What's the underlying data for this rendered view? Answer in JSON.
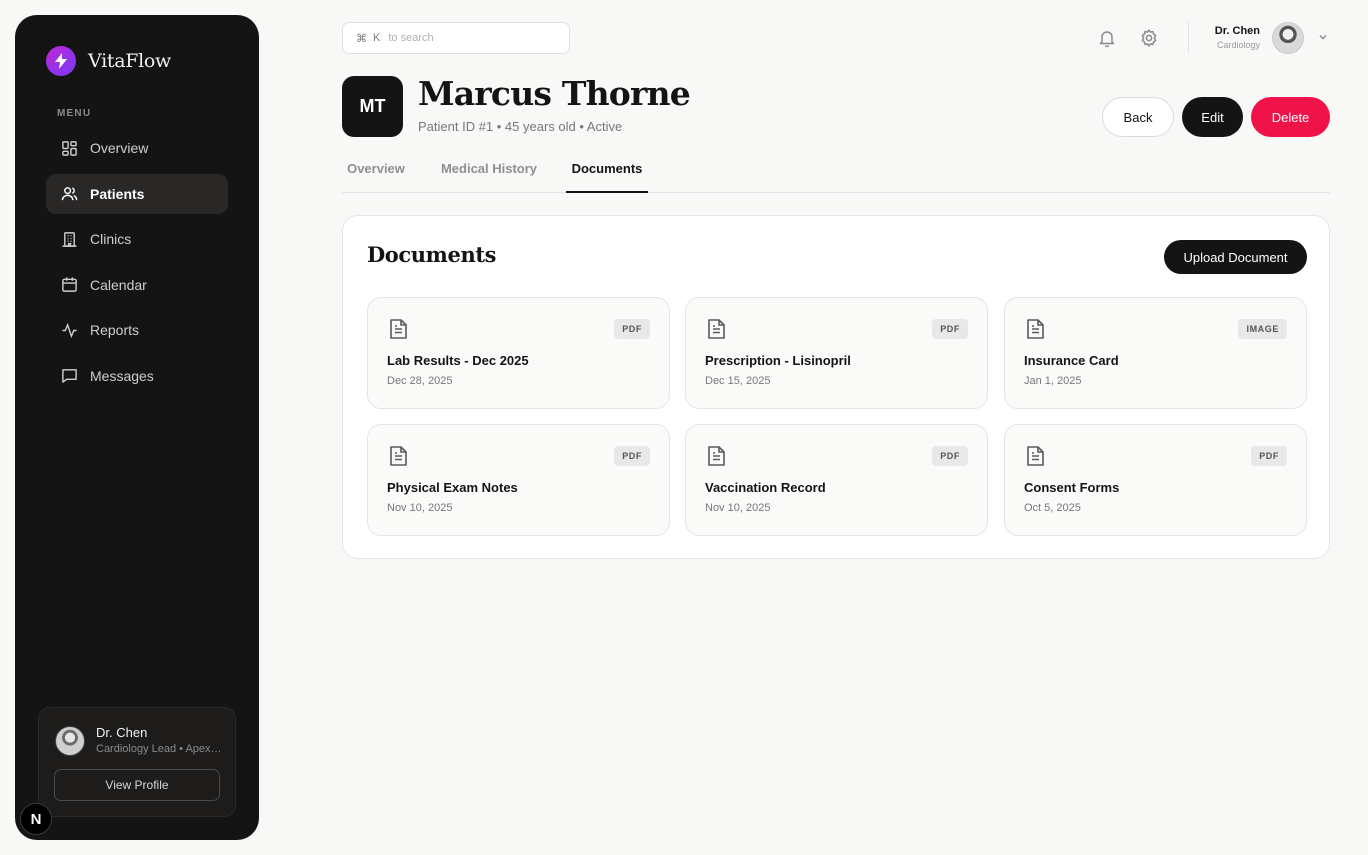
{
  "brand": {
    "name": "VitaFlow"
  },
  "sidebar": {
    "menu_label": "MENU",
    "items": [
      {
        "label": "Overview",
        "icon": "grid-icon",
        "active": false
      },
      {
        "label": "Patients",
        "icon": "users-icon",
        "active": true
      },
      {
        "label": "Clinics",
        "icon": "building-icon",
        "active": false
      },
      {
        "label": "Calendar",
        "icon": "calendar-icon",
        "active": false
      },
      {
        "label": "Reports",
        "icon": "activity-icon",
        "active": false
      },
      {
        "label": "Messages",
        "icon": "message-icon",
        "active": false
      }
    ],
    "profile": {
      "name": "Dr. Chen",
      "role": "Cardiology Lead • Apex Medical",
      "button": "View Profile"
    },
    "badge": "N"
  },
  "topbar": {
    "search_shortcut_symbol": "⌘",
    "search_shortcut_key": "K",
    "search_placeholder": "to search",
    "user_name": "Dr. Chen",
    "user_role": "Cardiology"
  },
  "patient": {
    "initials": "MT",
    "name": "Marcus Thorne",
    "meta": "Patient ID #1 • 45 years old • Active"
  },
  "actions": {
    "back": "Back",
    "edit": "Edit",
    "delete": "Delete"
  },
  "tabs": [
    {
      "label": "Overview",
      "active": false
    },
    {
      "label": "Medical History",
      "active": false
    },
    {
      "label": "Documents",
      "active": true
    }
  ],
  "documents": {
    "title": "Documents",
    "upload_label": "Upload Document",
    "items": [
      {
        "title": "Lab Results - Dec 2025",
        "date": "Dec 28, 2025",
        "type": "PDF"
      },
      {
        "title": "Prescription - Lisinopril",
        "date": "Dec 15, 2025",
        "type": "PDF"
      },
      {
        "title": "Insurance Card",
        "date": "Jan 1, 2025",
        "type": "IMAGE"
      },
      {
        "title": "Physical Exam Notes",
        "date": "Nov 10, 2025",
        "type": "PDF"
      },
      {
        "title": "Vaccination Record",
        "date": "Nov 10, 2025",
        "type": "PDF"
      },
      {
        "title": "Consent Forms",
        "date": "Oct 5, 2025",
        "type": "PDF"
      }
    ]
  },
  "colors": {
    "sidebar_bg": "#141414",
    "brand_gradient_start": "#c026d3",
    "delete": "#f0134a",
    "primary_button": "#141414"
  }
}
